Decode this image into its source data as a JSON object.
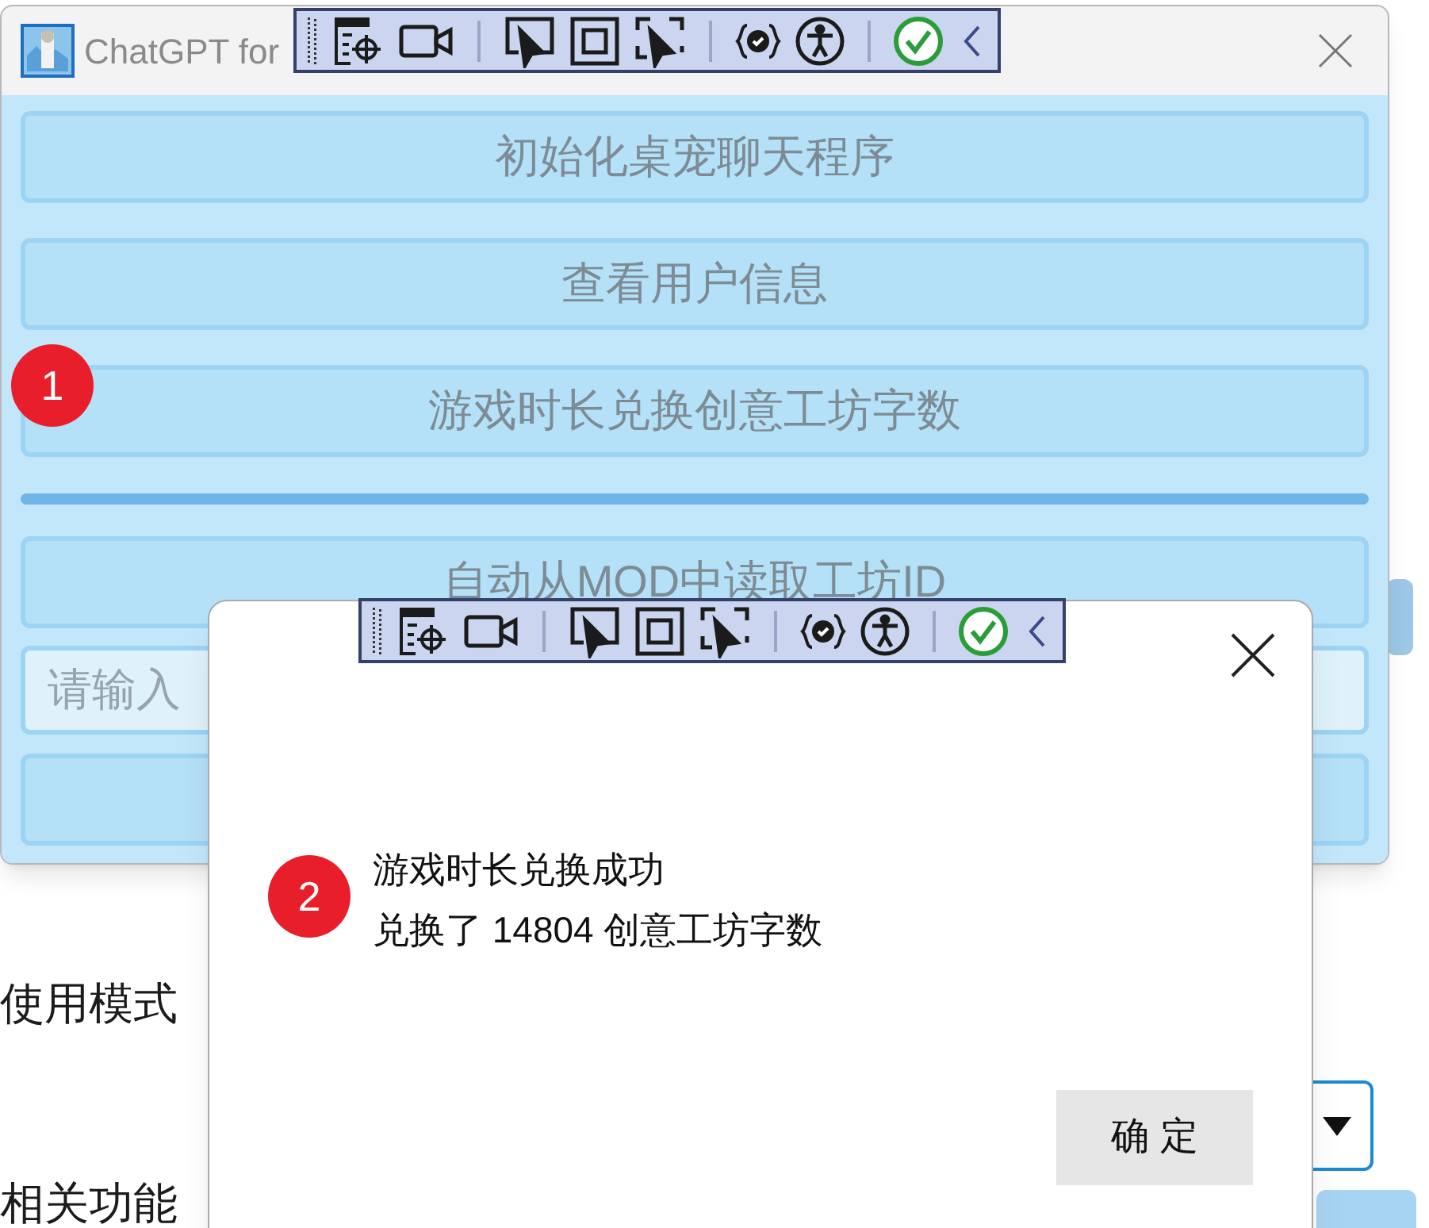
{
  "background": {
    "labels": [
      "使用模式",
      "相关功能"
    ]
  },
  "main_window": {
    "title": "ChatGPT for",
    "badge": "1",
    "items": [
      {
        "kind": "button",
        "label": "初始化桌宠聊天程序"
      },
      {
        "kind": "button",
        "label": "查看用户信息"
      },
      {
        "kind": "button",
        "label": "游戏时长兑换创意工坊字数"
      },
      {
        "kind": "divider"
      },
      {
        "kind": "button",
        "label": "自动从MOD中读取工坊ID"
      },
      {
        "kind": "input",
        "placeholder": "请输入"
      },
      {
        "kind": "button"
      }
    ]
  },
  "dialog": {
    "badge": "2",
    "lines": [
      "游戏时长兑换成功",
      "兑换了 14804 创意工坊字数"
    ],
    "ok_button": "确 定"
  }
}
